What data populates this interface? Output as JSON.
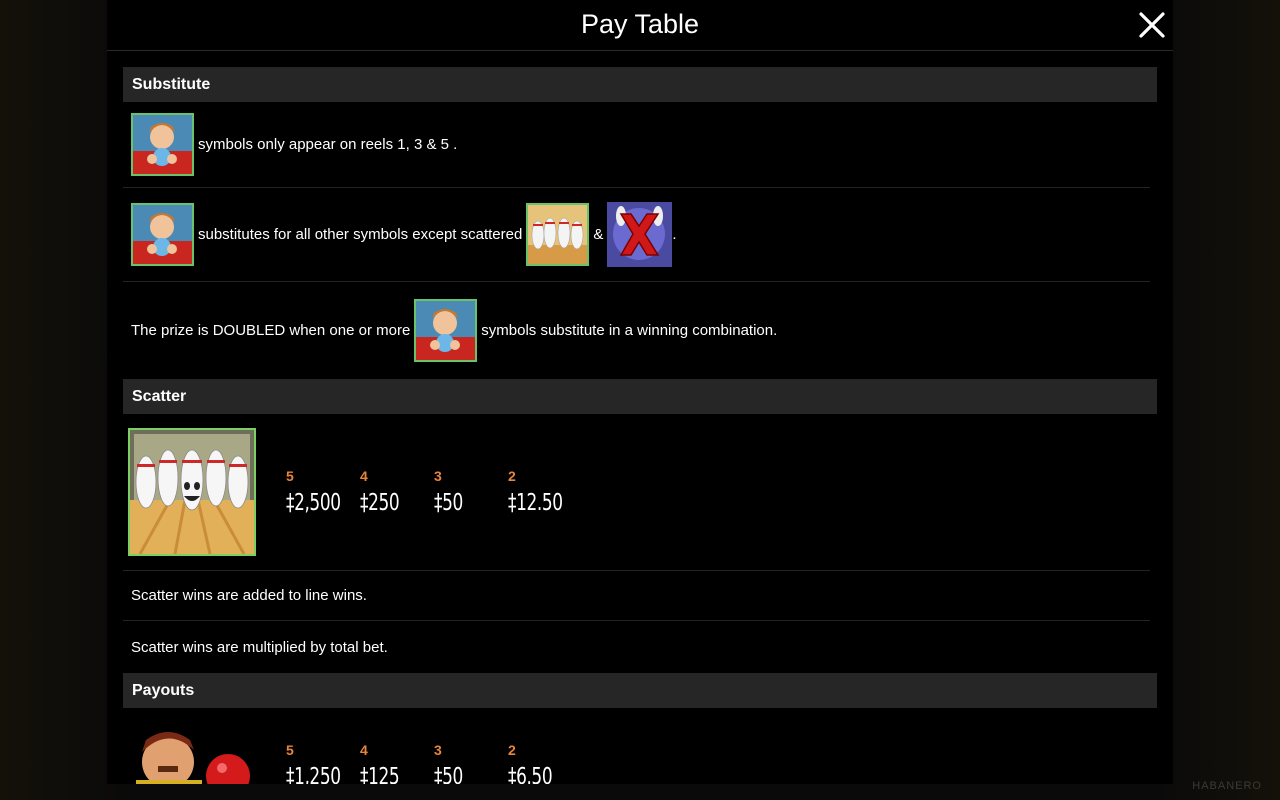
{
  "window": {
    "title": "Pay Table",
    "close_icon": "close-icon"
  },
  "watermark": "HABANERO",
  "substitute": {
    "header": "Substitute",
    "rows": [
      {
        "text": "symbols only appear on reels 1, 3 & 5 ."
      },
      {
        "text": "substitutes for all other symbols except scattered",
        "amp": "&",
        "end": "."
      },
      {
        "pre": "The prize is DOUBLED when one or more",
        "post": "symbols substitute in a winning combination."
      }
    ]
  },
  "scatter": {
    "header": "Scatter",
    "pays": [
      {
        "count": "5",
        "amount": "‡2,500"
      },
      {
        "count": "4",
        "amount": "‡250"
      },
      {
        "count": "3",
        "amount": "‡50"
      },
      {
        "count": "2",
        "amount": "‡12.50"
      }
    ],
    "notes": [
      "Scatter wins are added to line wins.",
      "Scatter wins are multiplied by total bet."
    ]
  },
  "payouts": {
    "header": "Payouts",
    "pays": [
      {
        "count": "5",
        "amount": "‡1,250"
      },
      {
        "count": "4",
        "amount": "‡125"
      },
      {
        "count": "3",
        "amount": "‡50"
      },
      {
        "count": "2",
        "amount": "‡6.50"
      }
    ]
  },
  "colors": {
    "accent": "#e9853a",
    "symbol_border": "#6ac36a",
    "section_bg": "#262626"
  }
}
